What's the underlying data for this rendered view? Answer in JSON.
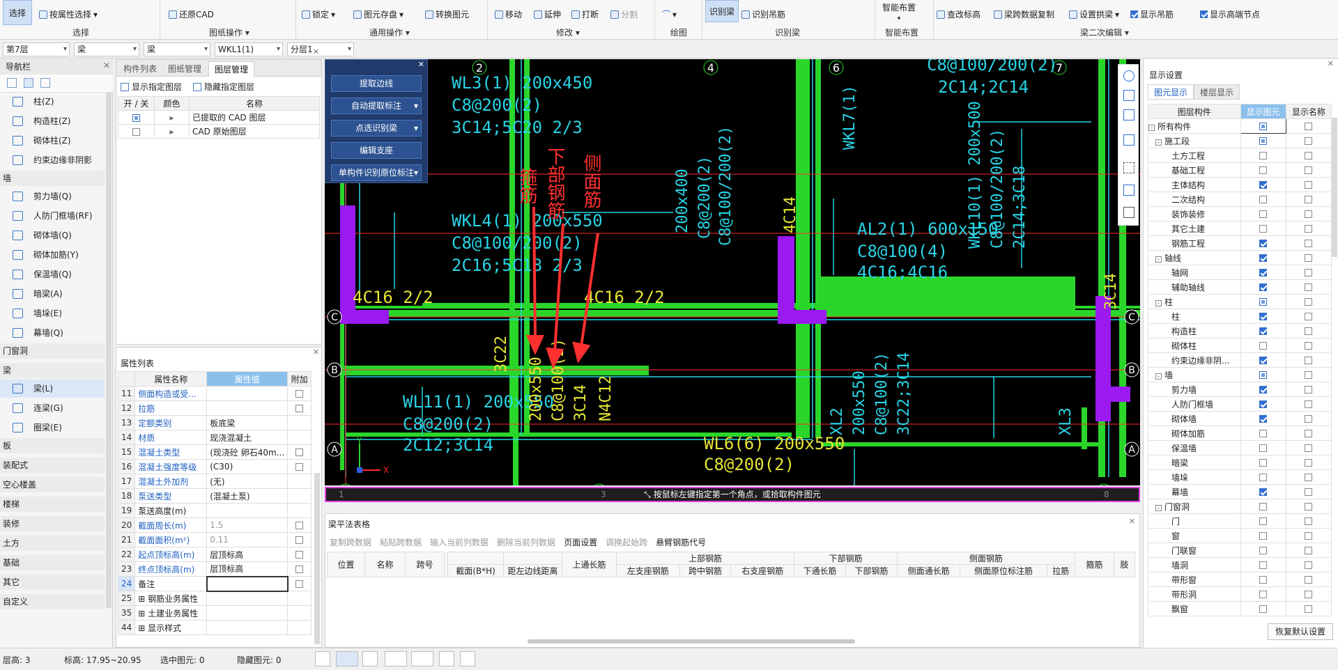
{
  "ribbon": {
    "select_label": "选择",
    "select_by_attr": "按属性选择",
    "select_group": "选择",
    "restore_cad": "还原CAD",
    "drawing_ops_group": "图纸操作",
    "lock": "锁定",
    "save_element": "图元存盘",
    "convert_element": "转换图元",
    "common_ops_group": "通用操作",
    "move": "移动",
    "extend": "延伸",
    "break": "打断",
    "split": "分割",
    "modify_group": "修改",
    "draw_group": "绘图",
    "identify_beam": "识别梁",
    "identify_hanger": "识别吊筋",
    "identify_beam_group": "识别梁",
    "smart_layout": "智能布置",
    "smart_layout_group": "智能布置",
    "query_elevation": "查改标高",
    "span_copy": "梁跨数据复制",
    "set_arch_beam": "设置拱梁",
    "show_hanger": "显示吊筋",
    "show_high_low_node": "显示高端节点",
    "secondary_edit_group": "梁二次编辑"
  },
  "filters": {
    "floor": "第7层",
    "category": "梁",
    "type": "梁",
    "element": "WKL1(1)",
    "layer": "分层1"
  },
  "nav": {
    "title": "导航栏",
    "items": [
      {
        "label": "柱(Z)"
      },
      {
        "label": "构造柱(Z)"
      },
      {
        "label": "砌体柱(Z)"
      },
      {
        "label": "约束边缘非阴影区..."
      }
    ],
    "cat_wall": "墙",
    "wall_items": [
      {
        "label": "剪力墙(Q)"
      },
      {
        "label": "人防门框墙(RF)"
      },
      {
        "label": "砌体墙(Q)"
      },
      {
        "label": "砌体加筋(Y)"
      },
      {
        "label": "保温墙(Q)"
      },
      {
        "label": "暗梁(A)"
      },
      {
        "label": "墙垛(E)"
      },
      {
        "label": "幕墙(Q)"
      }
    ],
    "cat_door": "门窗洞",
    "cat_beam": "梁",
    "beam_items": [
      {
        "label": "梁(L)"
      },
      {
        "label": "连梁(G)"
      },
      {
        "label": "圈梁(E)"
      }
    ],
    "other_cats": [
      "板",
      "装配式",
      "空心楼盖",
      "楼梯",
      "装修",
      "土方",
      "基础",
      "其它",
      "自定义"
    ]
  },
  "layer_panel": {
    "tabs": [
      "构件列表",
      "图纸管理",
      "图层管理"
    ],
    "show_layer": "显示指定图层",
    "hide_layer": "隐藏指定图层",
    "headers": [
      "开 / 关",
      "颜色",
      "名称"
    ],
    "rows": [
      {
        "name": "已提取的 CAD 图层"
      },
      {
        "name": "CAD 原始图层"
      }
    ]
  },
  "prop_panel": {
    "title": "属性列表",
    "headers": [
      "属性名称",
      "属性值",
      "附加"
    ],
    "rows": [
      {
        "num": "11",
        "name": "侧面构造或受...",
        "value": ""
      },
      {
        "num": "12",
        "name": "拉筋",
        "value": ""
      },
      {
        "num": "13",
        "name": "定额类别",
        "value": "板底梁"
      },
      {
        "num": "14",
        "name": "材质",
        "value": "现浇混凝土"
      },
      {
        "num": "15",
        "name": "混凝土类型",
        "value": "(现浇砼 卵石40m..."
      },
      {
        "num": "16",
        "name": "混凝土强度等级",
        "value": "(C30)"
      },
      {
        "num": "17",
        "name": "混凝土外加剂",
        "value": "(无)"
      },
      {
        "num": "18",
        "name": "泵送类型",
        "value": "(混凝土泵)"
      },
      {
        "num": "19",
        "name": "泵送高度(m)",
        "value": ""
      },
      {
        "num": "20",
        "name": "截面周长(m)",
        "value": "1.5"
      },
      {
        "num": "21",
        "name": "截面面积(m²)",
        "value": "0.11"
      },
      {
        "num": "22",
        "name": "起点顶标高(m)",
        "value": "层顶标高"
      },
      {
        "num": "23",
        "name": "终点顶标高(m)",
        "value": "层顶标高"
      },
      {
        "num": "24",
        "name": "备注",
        "value": ""
      },
      {
        "num": "25",
        "name": "钢筋业务属性",
        "value": ""
      },
      {
        "num": "35",
        "name": "土建业务属性",
        "value": ""
      },
      {
        "num": "44",
        "name": "显示样式",
        "value": ""
      }
    ]
  },
  "cad_panel": {
    "buttons": [
      "提取边线",
      "自动提取标注",
      "点选识别梁",
      "编辑支座",
      "单构件识别原位标注"
    ]
  },
  "cad": {
    "axis_top": [
      "2",
      "4",
      "6",
      "7"
    ],
    "axis_bottom": [
      "1",
      "3",
      "8"
    ],
    "axis_side": [
      "C",
      "B",
      "A"
    ],
    "texts": {
      "wl3": "WL3(1) 200x450",
      "wl3b": "C8@200(2)",
      "wl3c": "3C14;5C20 2/3",
      "wkl4": "WKL4(1) 200x550",
      "wkl4b": "C8@100/200(2)",
      "wkl4c": "2C16;5C18 2/3",
      "wl11": "WL11(1) 200x550",
      "wl11b": "C8@200(2)",
      "wl11c": "2C12;3C14",
      "v200x400": "200x400",
      "vc8_200": "C8@200(2)",
      "vc8_100": "C8@100/200(2)",
      "vc8_100b": "2C14;3C18",
      "wkl7": "WKL7(1)",
      "c8top": "C8@100/200(2)",
      "c14top": "2C14;2C14",
      "al2": "AL2(1) 600x150",
      "al2b": "C8@100(4)",
      "al2c": "4C16;4C16",
      "wkl10": "WKL10(1) 200x500",
      "wkl10b": "C8@100/200(2)",
      "wkl10c": "2C14;3C18",
      "c16a": "4C16 2/2",
      "c16b": "4C16 2/2",
      "c14v": "4C14",
      "c14v2": "3C14",
      "c22": "3C22",
      "y200x550": "200x550",
      "yc8": "C8@100(2)",
      "y3c14": "3C14",
      "yn4c12": "N4C12",
      "xl2": "XL2",
      "xl2b": "200x550",
      "xl2c": "C8@100(2)",
      "xl2d": "3C22;3C14",
      "xl3": "XL3",
      "wl6": "WL6(6) 200x550",
      "wl6b": "C8@200(2)",
      "ann1": "箍筋",
      "ann2": "下部钢筋",
      "ann3": "侧面筋",
      "ucs_x": "X",
      "ucs_y": "Y"
    },
    "status": "按鼠标左键指定第一个角点，或拾取构件图元"
  },
  "beam_table": {
    "title": "梁平法表格",
    "tools": [
      "复制跨数据",
      "粘贴跨数据",
      "输入当前列数据",
      "删除当前列数据",
      "页面设置",
      "调换起始跨",
      "悬臂钢筋代号"
    ],
    "h_position": "位置",
    "h_name": "名称",
    "h_span": "跨号",
    "h_section": "截面(B*H)",
    "h_dist": "距左边线距离",
    "h_top_long": "上通长筋",
    "h_upper": "上部钢筋",
    "h_left": "左支座钢筋",
    "h_mid": "跨中钢筋",
    "h_right": "右支座钢筋",
    "h_lower": "下部钢筋",
    "h_low_long": "下通长筋",
    "h_low_bar": "下部钢筋",
    "h_side": "侧面钢筋",
    "h_side_long": "侧面通长筋",
    "h_side_orig": "侧面原位标注筋",
    "h_tie": "拉筋",
    "h_stirrup": "箍筋",
    "h_more": "肢"
  },
  "right_panel": {
    "title": "显示设置",
    "tabs": [
      "图元显示",
      "楼层显示"
    ],
    "headers": [
      "图层构件",
      "显示图元",
      "显示名称"
    ],
    "rows": [
      {
        "label": "所有构件",
        "level": 0,
        "g": true,
        "a": "p",
        "b": "o"
      },
      {
        "label": "施工段",
        "level": 1,
        "g": true,
        "a": "p",
        "b": "o"
      },
      {
        "label": "土方工程",
        "level": 2,
        "a": "o",
        "b": "o"
      },
      {
        "label": "基础工程",
        "level": 2,
        "a": "o",
        "b": "o"
      },
      {
        "label": "主体结构",
        "level": 2,
        "a": "f",
        "b": "o"
      },
      {
        "label": "二次结构",
        "level": 2,
        "a": "o",
        "b": "o"
      },
      {
        "label": "装饰装修",
        "level": 2,
        "a": "o",
        "b": "o"
      },
      {
        "label": "其它土建",
        "level": 2,
        "a": "o",
        "b": "o"
      },
      {
        "label": "钢筋工程",
        "level": 2,
        "a": "f",
        "b": "o"
      },
      {
        "label": "轴线",
        "level": 1,
        "g": true,
        "a": "f",
        "b": "o"
      },
      {
        "label": "轴网",
        "level": 2,
        "a": "f",
        "b": "o"
      },
      {
        "label": "辅助轴线",
        "level": 2,
        "a": "f",
        "b": "o"
      },
      {
        "label": "柱",
        "level": 1,
        "g": true,
        "a": "p",
        "b": "o"
      },
      {
        "label": "柱",
        "level": 2,
        "a": "f",
        "b": "o"
      },
      {
        "label": "构造柱",
        "level": 2,
        "a": "f",
        "b": "o"
      },
      {
        "label": "砌体柱",
        "level": 2,
        "a": "o",
        "b": "o"
      },
      {
        "label": "约束边缘非阴...",
        "level": 2,
        "a": "f",
        "b": "o"
      },
      {
        "label": "墙",
        "level": 1,
        "g": true,
        "a": "p",
        "b": "o"
      },
      {
        "label": "剪力墙",
        "level": 2,
        "a": "f",
        "b": "o"
      },
      {
        "label": "人防门框墙",
        "level": 2,
        "a": "f",
        "b": "o"
      },
      {
        "label": "砌体墙",
        "level": 2,
        "a": "f",
        "b": "o"
      },
      {
        "label": "砌体加筋",
        "level": 2,
        "a": "o",
        "b": "o"
      },
      {
        "label": "保温墙",
        "level": 2,
        "a": "o",
        "b": "o"
      },
      {
        "label": "暗梁",
        "level": 2,
        "a": "o",
        "b": "o"
      },
      {
        "label": "墙垛",
        "level": 2,
        "a": "o",
        "b": "o"
      },
      {
        "label": "幕墙",
        "level": 2,
        "a": "f",
        "b": "o"
      },
      {
        "label": "门窗洞",
        "level": 1,
        "g": true,
        "a": "o",
        "b": "o"
      },
      {
        "label": "门",
        "level": 2,
        "a": "o",
        "b": "o"
      },
      {
        "label": "窗",
        "level": 2,
        "a": "o",
        "b": "o"
      },
      {
        "label": "门联窗",
        "level": 2,
        "a": "o",
        "b": "o"
      },
      {
        "label": "墙洞",
        "level": 2,
        "a": "o",
        "b": "o"
      },
      {
        "label": "带形窗",
        "level": 2,
        "a": "o",
        "b": "o"
      },
      {
        "label": "带形洞",
        "level": 2,
        "a": "o",
        "b": "o"
      },
      {
        "label": "飘窗",
        "level": 2,
        "a": "o",
        "b": "o"
      }
    ],
    "restore_btn": "恢复默认设置"
  },
  "status": {
    "floor_height": "层高:  3",
    "elevation": "标高:  17.95~20.95",
    "selected": "选中图元:  0",
    "hidden": "隐藏图元:  0"
  }
}
